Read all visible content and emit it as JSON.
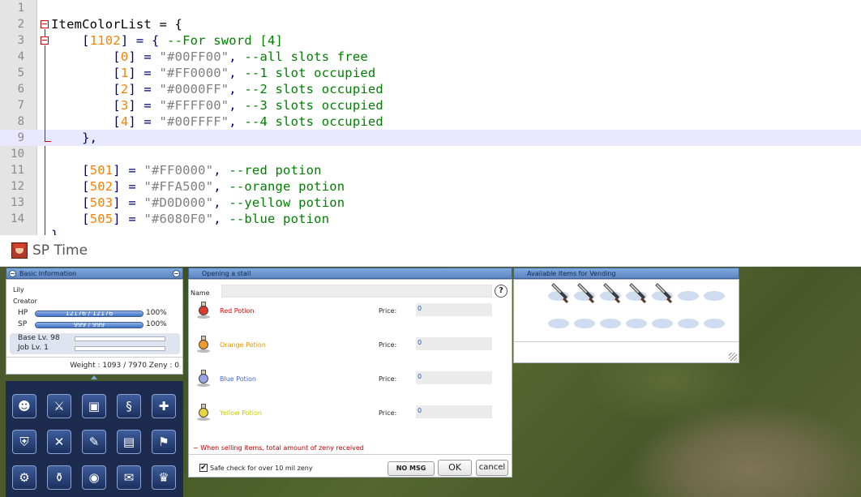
{
  "editor": {
    "lines": [
      {
        "n": "1",
        "segs": []
      },
      {
        "n": "2",
        "segs": [
          {
            "t": "ItemColorList = {",
            "c": "#000000"
          }
        ]
      },
      {
        "n": "3",
        "segs": [
          {
            "t": "    ",
            "c": "#000000"
          },
          {
            "t": "[",
            "c": "#000080"
          },
          {
            "t": "1102",
            "c": "#ff8000"
          },
          {
            "t": "] = { ",
            "c": "#000080"
          },
          {
            "t": "--For sword [4]",
            "c": "#008000"
          }
        ]
      },
      {
        "n": "4",
        "segs": [
          {
            "t": "        ",
            "c": "#000000"
          },
          {
            "t": "[",
            "c": "#000080"
          },
          {
            "t": "0",
            "c": "#ff8000"
          },
          {
            "t": "] = ",
            "c": "#000080"
          },
          {
            "t": "\"#00FF00\"",
            "c": "#808080"
          },
          {
            "t": ", ",
            "c": "#000080"
          },
          {
            "t": "--all slots free",
            "c": "#008000"
          }
        ]
      },
      {
        "n": "5",
        "segs": [
          {
            "t": "        ",
            "c": "#000000"
          },
          {
            "t": "[",
            "c": "#000080"
          },
          {
            "t": "1",
            "c": "#ff8000"
          },
          {
            "t": "] = ",
            "c": "#000080"
          },
          {
            "t": "\"#FF0000\"",
            "c": "#808080"
          },
          {
            "t": ", ",
            "c": "#000080"
          },
          {
            "t": "--1 slot occupied",
            "c": "#008000"
          }
        ]
      },
      {
        "n": "6",
        "segs": [
          {
            "t": "        ",
            "c": "#000000"
          },
          {
            "t": "[",
            "c": "#000080"
          },
          {
            "t": "2",
            "c": "#ff8000"
          },
          {
            "t": "] = ",
            "c": "#000080"
          },
          {
            "t": "\"#0000FF\"",
            "c": "#808080"
          },
          {
            "t": ", ",
            "c": "#000080"
          },
          {
            "t": "--2 slots occupied",
            "c": "#008000"
          }
        ]
      },
      {
        "n": "7",
        "segs": [
          {
            "t": "        ",
            "c": "#000000"
          },
          {
            "t": "[",
            "c": "#000080"
          },
          {
            "t": "3",
            "c": "#ff8000"
          },
          {
            "t": "] = ",
            "c": "#000080"
          },
          {
            "t": "\"#FFFF00\"",
            "c": "#808080"
          },
          {
            "t": ", ",
            "c": "#000080"
          },
          {
            "t": "--3 slots occupied",
            "c": "#008000"
          }
        ]
      },
      {
        "n": "8",
        "segs": [
          {
            "t": "        ",
            "c": "#000000"
          },
          {
            "t": "[",
            "c": "#000080"
          },
          {
            "t": "4",
            "c": "#ff8000"
          },
          {
            "t": "] = ",
            "c": "#000080"
          },
          {
            "t": "\"#00FFFF\"",
            "c": "#808080"
          },
          {
            "t": ", ",
            "c": "#000080"
          },
          {
            "t": "--4 slots occupied",
            "c": "#008000"
          }
        ]
      },
      {
        "n": "9",
        "segs": [
          {
            "t": "    },",
            "c": "#000080"
          }
        ]
      },
      {
        "n": "10",
        "segs": []
      },
      {
        "n": "11",
        "segs": [
          {
            "t": "    ",
            "c": "#000000"
          },
          {
            "t": "[",
            "c": "#000080"
          },
          {
            "t": "501",
            "c": "#ff8000"
          },
          {
            "t": "] = ",
            "c": "#000080"
          },
          {
            "t": "\"#FF0000\"",
            "c": "#808080"
          },
          {
            "t": ", ",
            "c": "#000080"
          },
          {
            "t": "--red potion",
            "c": "#008000"
          }
        ]
      },
      {
        "n": "12",
        "segs": [
          {
            "t": "    ",
            "c": "#000000"
          },
          {
            "t": "[",
            "c": "#000080"
          },
          {
            "t": "502",
            "c": "#ff8000"
          },
          {
            "t": "] = ",
            "c": "#000080"
          },
          {
            "t": "\"#FFA500\"",
            "c": "#808080"
          },
          {
            "t": ", ",
            "c": "#000080"
          },
          {
            "t": "--orange potion",
            "c": "#008000"
          }
        ]
      },
      {
        "n": "13",
        "segs": [
          {
            "t": "    ",
            "c": "#000000"
          },
          {
            "t": "[",
            "c": "#000080"
          },
          {
            "t": "503",
            "c": "#ff8000"
          },
          {
            "t": "] = ",
            "c": "#000080"
          },
          {
            "t": "\"#D0D000\"",
            "c": "#808080"
          },
          {
            "t": ", ",
            "c": "#000080"
          },
          {
            "t": "--yellow potion",
            "c": "#008000"
          }
        ]
      },
      {
        "n": "14",
        "segs": [
          {
            "t": "    ",
            "c": "#000000"
          },
          {
            "t": "[",
            "c": "#000080"
          },
          {
            "t": "505",
            "c": "#ff8000"
          },
          {
            "t": "] = ",
            "c": "#000080"
          },
          {
            "t": "\"#6080F0\"",
            "c": "#808080"
          },
          {
            "t": ", ",
            "c": "#000080"
          },
          {
            "t": "--blue potion",
            "c": "#008000"
          }
        ]
      },
      {
        "n": "",
        "segs": [
          {
            "t": "}",
            "c": "#000080"
          }
        ]
      }
    ]
  },
  "window": {
    "title": "SP Time"
  },
  "basic_info": {
    "header": "Basic Information",
    "name": "Lily",
    "job": "Creator",
    "hp_label": "HP",
    "hp_value": "12176  /  12176",
    "hp_percent": "100%",
    "hp_fraction": 1.0,
    "sp_label": "SP",
    "sp_value": "999  /  999",
    "sp_percent": "100%",
    "sp_fraction": 1.0,
    "base_level": "Base Lv. 98",
    "job_level": "Job Lv. 1",
    "weight_zeny": "Weight : 1093 / 7970  Zeny : 0"
  },
  "skill_icons": [
    "character-icon",
    "equipment-icon",
    "items-icon",
    "skills-icon",
    "party-icon",
    "guild-icon",
    "battle-icon",
    "quest-icon",
    "map-icon",
    "golf-icon",
    "options-icon",
    "storage-icon",
    "camera-icon",
    "mail-icon",
    "trophy-icon"
  ],
  "stall": {
    "header": "Opening a stall",
    "name_label": "Name",
    "name_value": "",
    "help": "?",
    "items": [
      {
        "name": "Red Potion",
        "color": "#e00000",
        "price_label": "Price:",
        "price": "0",
        "potion_color": "#d93a2a"
      },
      {
        "name": "Orange Potion",
        "color": "#e89400",
        "price_label": "Price:",
        "price": "0",
        "potion_color": "#f09a2a"
      },
      {
        "name": "Blue Potion",
        "color": "#4466dd",
        "price_label": "Price:",
        "price": "0",
        "potion_color": "#9aa6e6"
      },
      {
        "name": "Yellow Potion",
        "color": "#c8c800",
        "price_label": "Price:",
        "price": "0",
        "potion_color": "#e6d640"
      }
    ],
    "note": "~ When selling items, total amount of zeny received",
    "safe_check_label": "Safe check for over 10 mil zeny",
    "safe_checked": true,
    "buttons": {
      "nomsg": "NO MSG",
      "ok": "OK",
      "cancel": "cancel"
    }
  },
  "vending": {
    "header": "Available Items for Vending",
    "sword_count": 5,
    "slot_count": 14
  }
}
